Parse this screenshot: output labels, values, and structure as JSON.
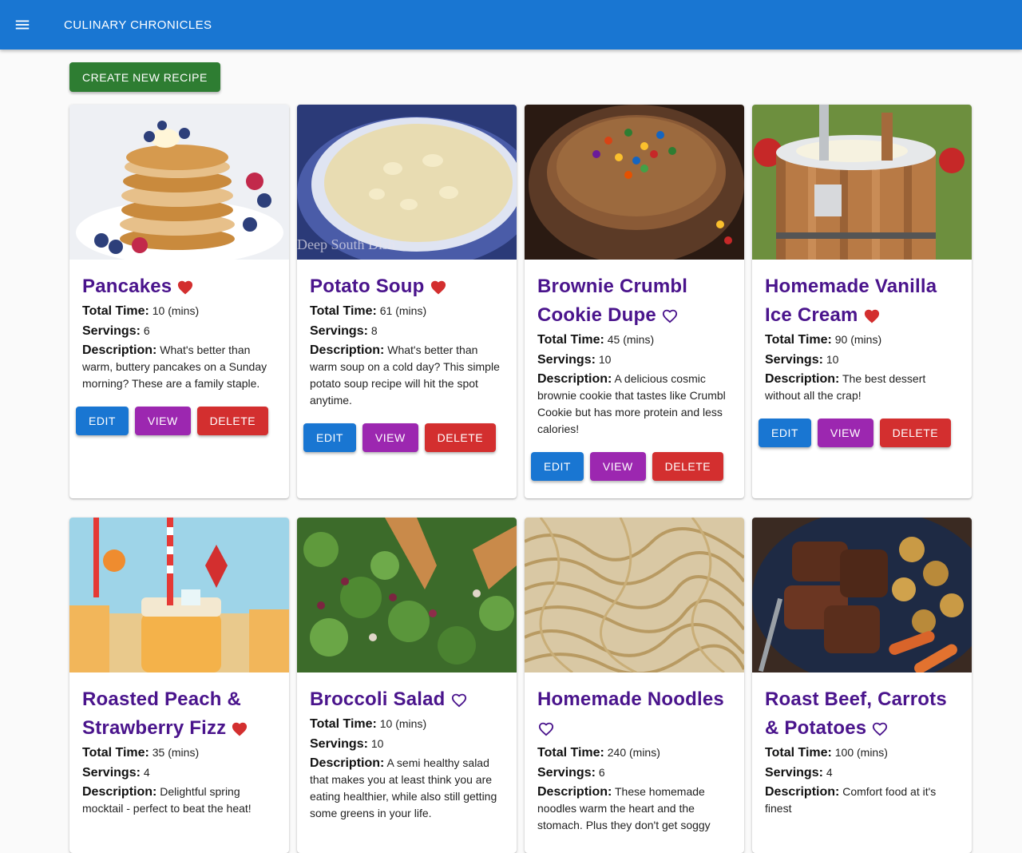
{
  "app": {
    "title": "CULINARY CHRONICLES",
    "menu_icon": "hamburger-menu-icon"
  },
  "toolbar": {
    "create_label": "CREATE NEW RECIPE"
  },
  "labels": {
    "total_time": "Total Time:",
    "servings": "Servings:",
    "description": "Description:",
    "mins_suffix": "(mins)",
    "edit": "EDIT",
    "view": "VIEW",
    "delete": "DELETE"
  },
  "colors": {
    "appbar": "#1976d2",
    "create": "#2e7d32",
    "edit": "#1976d2",
    "view": "#9c27b0",
    "delete": "#d32f2f",
    "title": "#4a148c",
    "heart": "#d32f2f"
  },
  "recipes": [
    {
      "title": "Pancakes",
      "favorite": true,
      "total_time": "10",
      "servings": "6",
      "description": "What's better than warm, buttery pancakes on a Sunday morning? These are a family staple."
    },
    {
      "title": "Potato Soup",
      "favorite": true,
      "total_time": "61",
      "servings": "8",
      "description": "What's better than warm soup on a cold day? This simple potato soup recipe will hit the spot anytime.",
      "watermark": "Deep South Dish"
    },
    {
      "title": "Brownie Crumbl Cookie Dupe",
      "favorite": false,
      "total_time": "45",
      "servings": "10",
      "description": "A delicious cosmic brownie cookie that tastes like Crumbl Cookie but has more protein and less calories!"
    },
    {
      "title": "Homemade Vanilla Ice Cream",
      "favorite": true,
      "total_time": "90",
      "servings": "10",
      "description": "The best dessert without all the crap!"
    },
    {
      "title": "Roasted Peach & Strawberry Fizz",
      "favorite": true,
      "total_time": "35",
      "servings": "4",
      "description": "Delightful spring mocktail - perfect to beat the heat!"
    },
    {
      "title": "Broccoli Salad",
      "favorite": false,
      "total_time": "10",
      "servings": "10",
      "description": "A semi healthy salad that makes you at least think you are eating healthier, while also still getting some greens in your life."
    },
    {
      "title": "Homemade Noodles",
      "favorite": false,
      "total_time": "240",
      "servings": "6",
      "description": "These homemade noodles warm the heart and the stomach. Plus they don't get soggy"
    },
    {
      "title": "Roast Beef, Carrots & Potatoes",
      "favorite": false,
      "total_time": "100",
      "servings": "4",
      "description": "Comfort food at it's finest"
    }
  ]
}
